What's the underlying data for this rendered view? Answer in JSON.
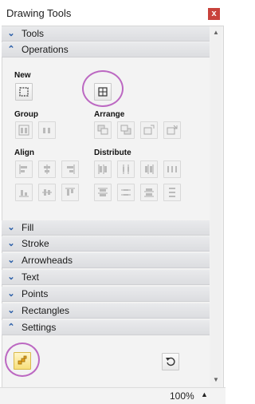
{
  "window": {
    "title": "Drawing Tools",
    "close_glyph": "x"
  },
  "sections": [
    {
      "label": "Tools",
      "state": "collapsed"
    },
    {
      "label": "Operations",
      "state": "expanded"
    },
    {
      "label": "Fill",
      "state": "collapsed"
    },
    {
      "label": "Stroke",
      "state": "collapsed"
    },
    {
      "label": "Arrowheads",
      "state": "collapsed"
    },
    {
      "label": "Text",
      "state": "collapsed"
    },
    {
      "label": "Points",
      "state": "collapsed"
    },
    {
      "label": "Rectangles",
      "state": "collapsed"
    },
    {
      "label": "Settings",
      "state": "expanded"
    }
  ],
  "operations": {
    "new_label": "New",
    "group_label": "Group",
    "arrange_label": "Arrange",
    "align_label": "Align",
    "distribute_label": "Distribute"
  },
  "status": {
    "zoom": "100%"
  },
  "colors": {
    "highlight_circle": "#b24fb8",
    "chevron": "#2a5ea8",
    "close": "#c8423c"
  }
}
